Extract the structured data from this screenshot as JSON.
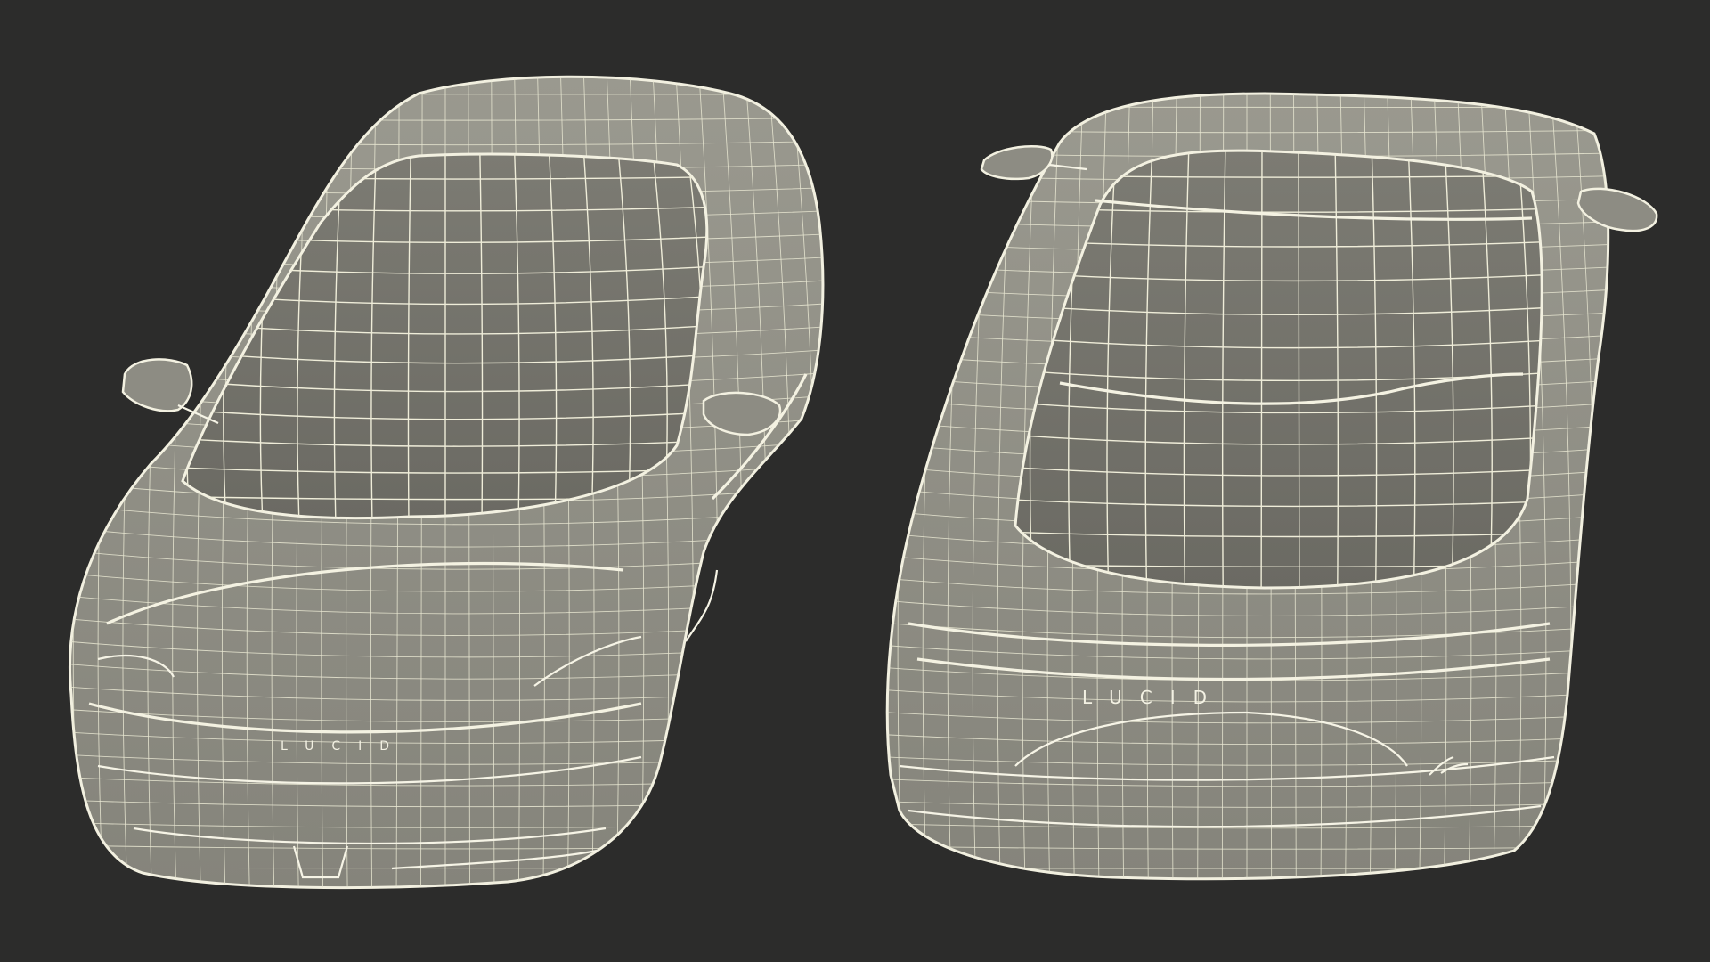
{
  "scene": {
    "background": "#2c2c2b",
    "wire_color": "#efedd9",
    "body_fill": "#8f8e85",
    "glass_fill": "#6f6e66"
  },
  "views": [
    {
      "id": "front-three-quarter",
      "badge": "LUCID"
    },
    {
      "id": "rear-three-quarter",
      "badge": "LUCID"
    }
  ]
}
